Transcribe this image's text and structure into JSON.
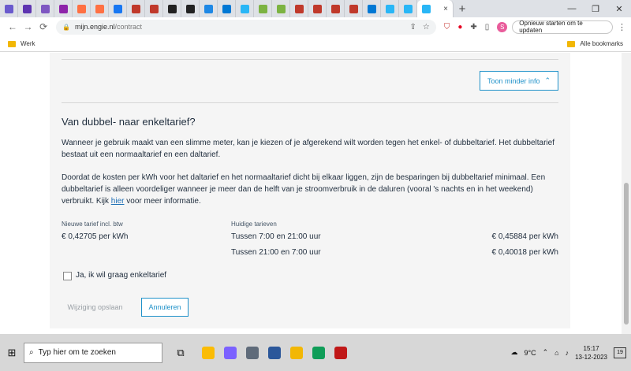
{
  "browser": {
    "url_domain": "mijn.engie.nl",
    "url_path": "/contract",
    "restart_label": "Opnieuw starten om te updaten",
    "profile_initial": "S",
    "tab_close": "×",
    "new_tab": "+",
    "window_min": "—",
    "window_max": "❐",
    "window_close": "✕",
    "back": "←",
    "forward": "→",
    "reload": "⟳",
    "menu": "⋮"
  },
  "tabs": [
    {
      "color": "#6a5acd"
    },
    {
      "color": "#5e35b1"
    },
    {
      "color": "#7e57c2"
    },
    {
      "color": "#8e24aa"
    },
    {
      "color": "#ff7043"
    },
    {
      "color": "#ff7043"
    },
    {
      "color": "#1877f2"
    },
    {
      "color": "#c0392b"
    },
    {
      "color": "#c0392b"
    },
    {
      "color": "#222222"
    },
    {
      "color": "#222222"
    },
    {
      "color": "#1e88e5"
    },
    {
      "color": "#0078d4"
    },
    {
      "color": "#29b6f6"
    },
    {
      "color": "#7cb342"
    },
    {
      "color": "#7cb342"
    },
    {
      "color": "#c0392b"
    },
    {
      "color": "#c0392b"
    },
    {
      "color": "#c0392b"
    },
    {
      "color": "#c0392b"
    },
    {
      "color": "#0078d4"
    },
    {
      "color": "#29b6f6"
    },
    {
      "color": "#29b6f6"
    }
  ],
  "bookmarks": {
    "folder_label": "Werk",
    "all_label": "Alle bookmarks"
  },
  "content": {
    "toggle_label": "Toon minder info",
    "title": "Van dubbel- naar enkeltarief?",
    "p1": "Wanneer je gebruik maakt van een slimme meter, kan je kiezen of je afgerekend wilt worden tegen het enkel- of dubbeltarief. Het dubbeltarief bestaat uit een normaaltarief en een daltarief.",
    "p2_before": "Doordat de kosten per kWh voor het daltarief en het normaaltarief dicht bij elkaar liggen, zijn de besparingen bij dubbeltarief minimaal. Een dubbeltarief is alleen voordeliger wanneer je meer dan de helft van je stroomverbruik in de daluren (vooral 's nachts en in het weekend) verbruikt. Kijk ",
    "p2_link": "hier",
    "p2_after": " voor meer informatie.",
    "new_rate_label": "Nieuwe tarief incl. btw",
    "new_rate_value": "€ 0,42705 per kWh",
    "current_rates_label": "Huidige tarieven",
    "current_rates": [
      {
        "period": "Tussen 7:00 en 21:00 uur",
        "price": "€ 0,45884 per kWh"
      },
      {
        "period": "Tussen 21:00 en 7:00 uur",
        "price": "€ 0,40018 per kWh"
      }
    ],
    "checkbox_label": "Ja, ik wil graag enkeltarief",
    "save_label": "Wijziging opslaan",
    "cancel_label": "Annuleren"
  },
  "taskbar": {
    "search_placeholder": "Typ hier om te zoeken",
    "weather": "9°C",
    "time": "15:17",
    "date": "13-12-2023",
    "notifications": "19",
    "apps": [
      {
        "name": "chrome",
        "color": "#fbbc05"
      },
      {
        "name": "copilot",
        "color": "#7b61ff"
      },
      {
        "name": "calculator",
        "color": "#5f6b7a"
      },
      {
        "name": "word",
        "color": "#2b579a"
      },
      {
        "name": "explorer",
        "color": "#f2b705"
      },
      {
        "name": "edge",
        "color": "#0f9d58"
      },
      {
        "name": "mcafee",
        "color": "#c01818"
      }
    ]
  }
}
